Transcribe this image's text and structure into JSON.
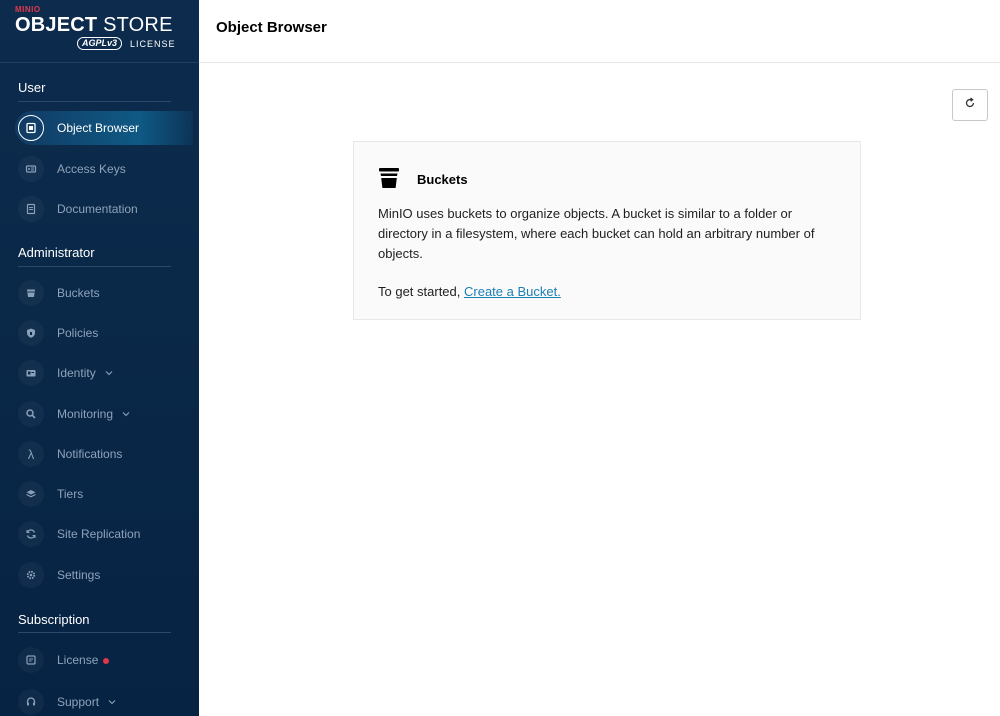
{
  "brand": {
    "maker": "MINIO",
    "product_bold": "OBJECT",
    "product_light": " STORE",
    "badge": "AGPLv3",
    "license_label": "LICENSE"
  },
  "header": {
    "title": "Object Browser"
  },
  "sidebar": {
    "sections": [
      {
        "title": "User"
      },
      {
        "title": "Administrator"
      },
      {
        "title": "Subscription"
      }
    ],
    "items": [
      {
        "label": "Object Browser",
        "icon": "object-browser-icon",
        "active": true
      },
      {
        "label": "Access Keys",
        "icon": "key-card-icon"
      },
      {
        "label": "Documentation",
        "icon": "document-icon"
      },
      {
        "label": "Buckets",
        "icon": "bucket-icon"
      },
      {
        "label": "Policies",
        "icon": "shield-icon"
      },
      {
        "label": "Identity",
        "icon": "id-card-icon",
        "expandable": true
      },
      {
        "label": "Monitoring",
        "icon": "magnifier-icon",
        "expandable": true
      },
      {
        "label": "Notifications",
        "icon": "lambda-icon"
      },
      {
        "label": "Tiers",
        "icon": "layers-icon"
      },
      {
        "label": "Site Replication",
        "icon": "sync-icon"
      },
      {
        "label": "Settings",
        "icon": "gear-icon"
      },
      {
        "label": "License",
        "icon": "license-icon",
        "alert": true
      },
      {
        "label": "Support",
        "icon": "support-icon",
        "expandable": true
      }
    ]
  },
  "toolbar": {
    "refresh_icon": "refresh-icon"
  },
  "empty_state": {
    "title": "Buckets",
    "description": "MinIO uses buckets to organize objects. A bucket is similar to a folder or directory in a filesystem, where each bucket can hold an arbitrary number of objects.",
    "cta_prefix": "To get started, ",
    "cta_link": "Create a Bucket."
  },
  "colors": {
    "sidebar_bg": "#0a2848",
    "brand_red": "#e23a4a",
    "link": "#1c7fb4",
    "alert_dot": "#e2344a"
  }
}
